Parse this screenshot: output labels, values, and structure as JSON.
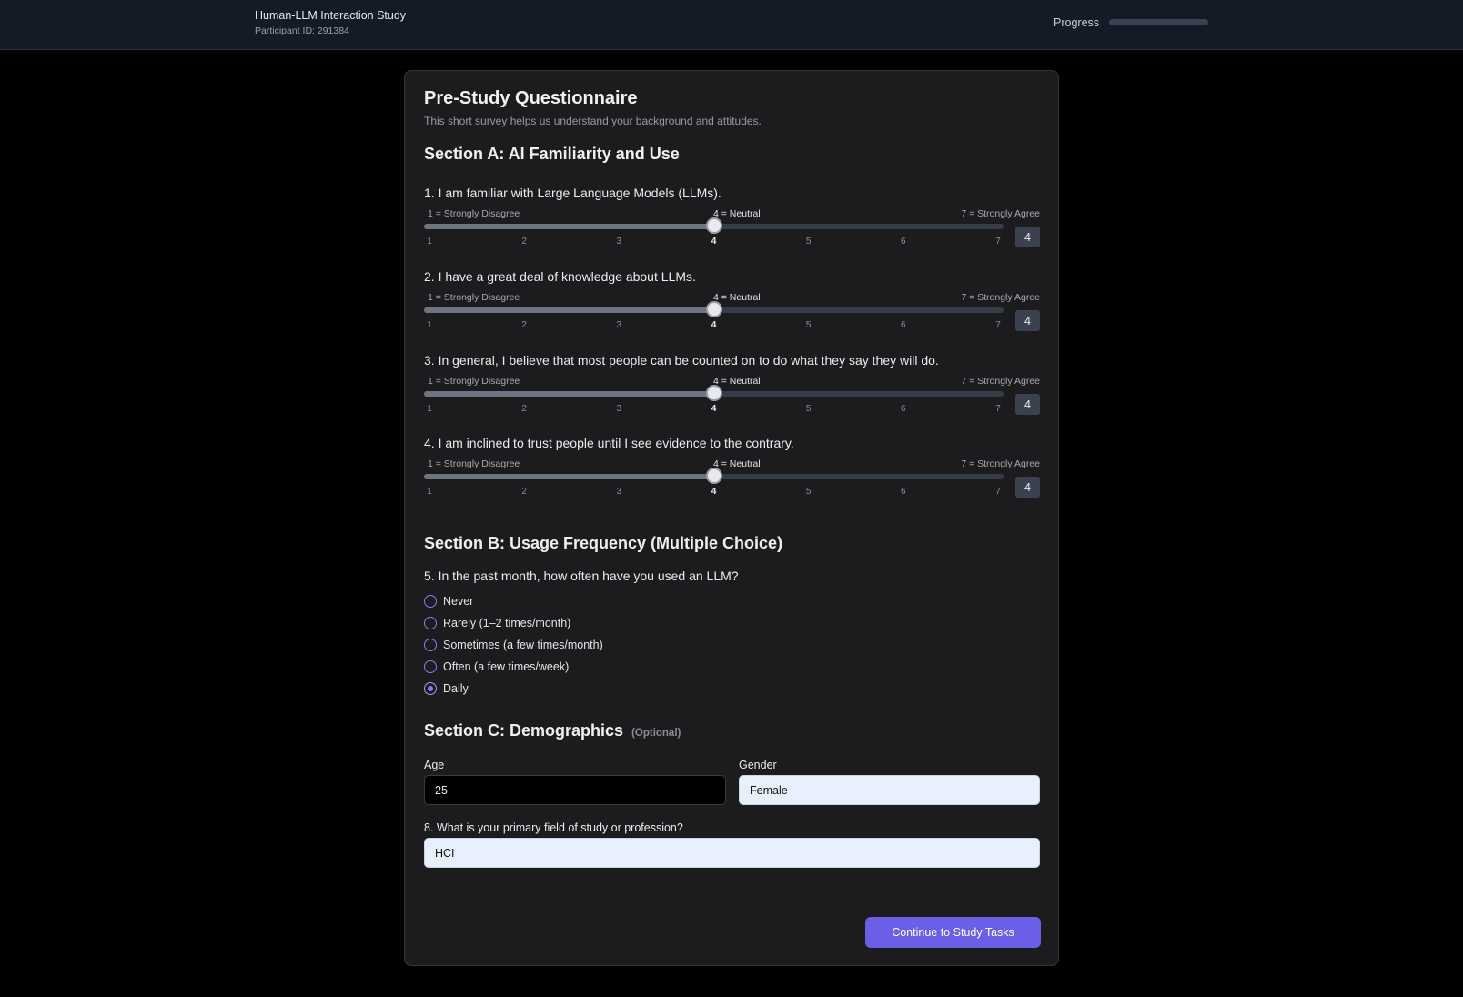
{
  "header": {
    "title": "Human-LLM Interaction Study",
    "participant": "Participant ID: 291384",
    "progress_label": "Progress",
    "progress_fraction": 0
  },
  "page": {
    "title": "Pre-Study Questionnaire",
    "subtitle": "This short survey helps us understand your background and attitudes."
  },
  "section_a": {
    "title": "Section A: AI Familiarity and Use",
    "anchor_left": "1 = Strongly Disagree",
    "anchor_mid": "4 = Neutral",
    "anchor_right": "7 = Strongly Agree",
    "scale": [
      "1",
      "2",
      "3",
      "4",
      "5",
      "6",
      "7"
    ],
    "questions": [
      {
        "text": "1. I am familiar with Large Language Models (LLMs).",
        "value": "4"
      },
      {
        "text": "2. I have a great deal of knowledge about LLMs.",
        "value": "4"
      },
      {
        "text": "3. In general, I believe that most people can be counted on to do what they say they will do.",
        "value": "4"
      },
      {
        "text": "4. I am inclined to trust people until I see evidence to the contrary.",
        "value": "4"
      }
    ]
  },
  "section_b": {
    "title": "Section B: Usage Frequency (Multiple Choice)",
    "question": "5. In the past month, how often have you used an LLM?",
    "options": [
      {
        "label": "Never",
        "checked": false
      },
      {
        "label": "Rarely (1–2 times/month)",
        "checked": false
      },
      {
        "label": "Sometimes (a few times/month)",
        "checked": false
      },
      {
        "label": "Often (a few times/week)",
        "checked": false
      },
      {
        "label": "Daily",
        "checked": true
      }
    ]
  },
  "section_c": {
    "title": "Section C: Demographics",
    "optional": "(Optional)",
    "age_label": "Age",
    "age_value": "25",
    "gender_label": "Gender",
    "gender_value": "Female",
    "field_label": "8. What is your primary field of study or profession?",
    "field_value": "HCI"
  },
  "actions": {
    "continue_label": "Continue to Study Tasks"
  },
  "colors": {
    "accent": "#6a5fe6",
    "background": "#000000",
    "card": "#1c1c1e",
    "header": "#141a26"
  }
}
